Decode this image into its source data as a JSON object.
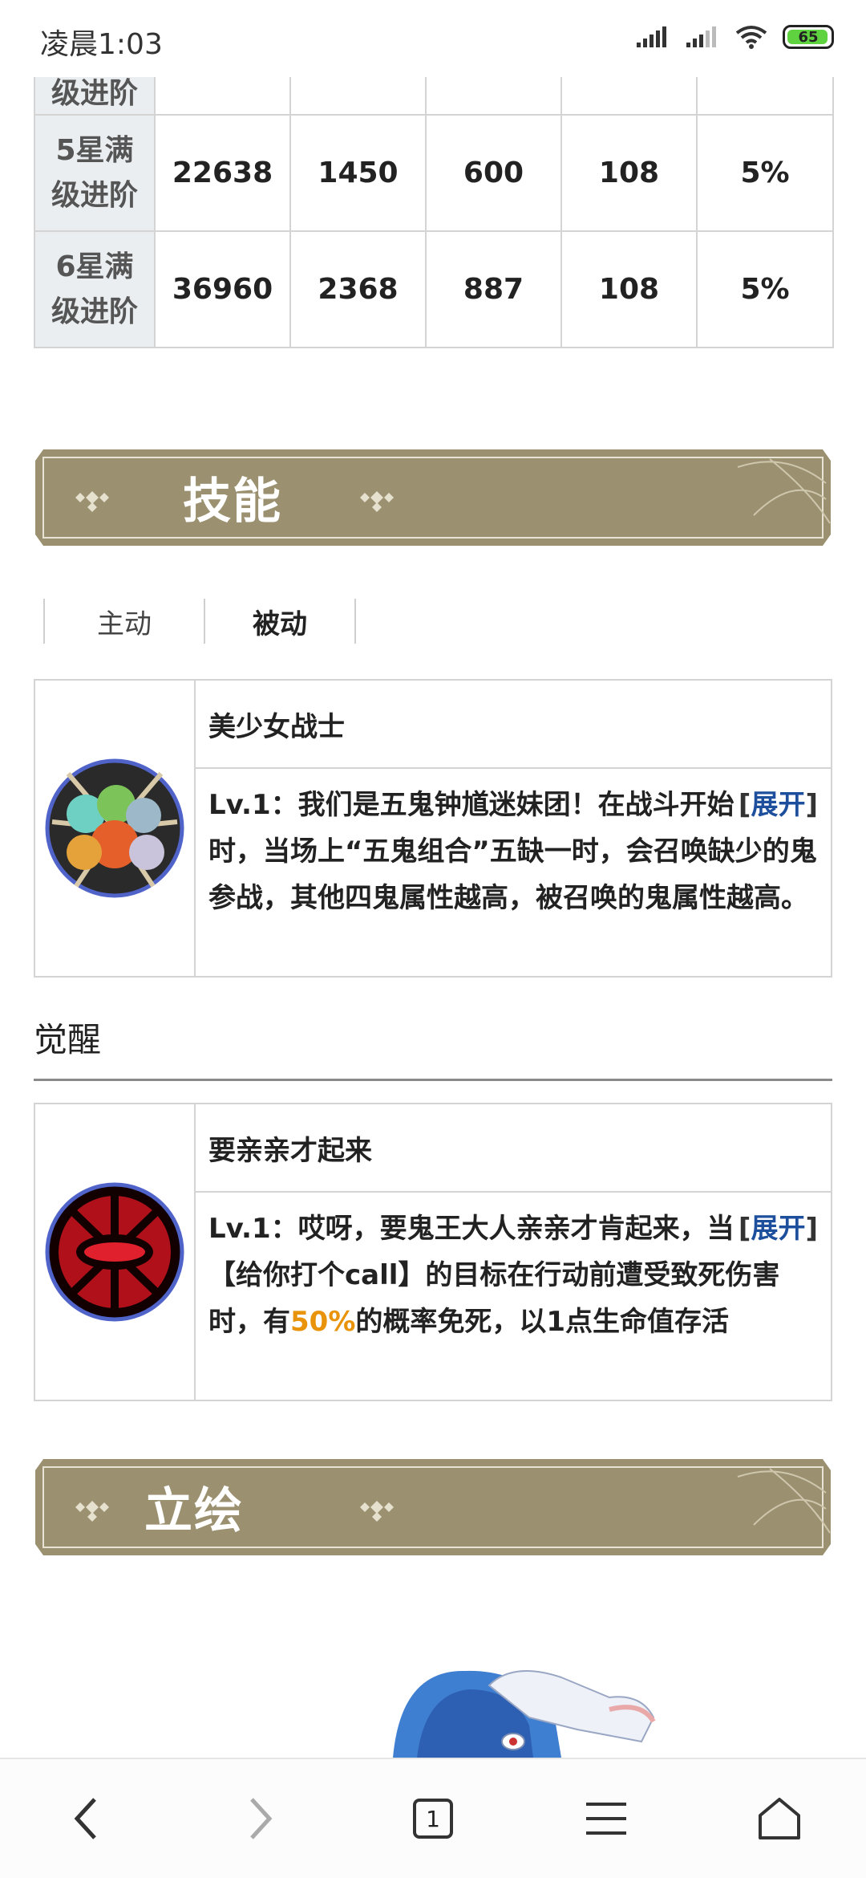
{
  "status_bar": {
    "time": "凌晨1:03",
    "battery": "65"
  },
  "stats_table": {
    "partial_row_label": "级进阶",
    "rows": [
      {
        "label_line1": "5星满",
        "label_line2": "级进阶",
        "values": [
          "22638",
          "1450",
          "600",
          "108",
          "5%"
        ]
      },
      {
        "label_line1": "6星满",
        "label_line2": "级进阶",
        "values": [
          "36960",
          "2368",
          "887",
          "108",
          "5%"
        ]
      }
    ]
  },
  "skills_section": {
    "title": "技能",
    "tabs": [
      {
        "label": "主动",
        "active": false
      },
      {
        "label": "被动",
        "active": true
      }
    ],
    "skill": {
      "name": "美少女战士",
      "desc": "Lv.1：我们是五鬼钟馗迷妹团！在战斗开始时，当场上“五鬼组合”五缺一时，会召唤缺少的鬼参战，其他四鬼属性越高，被召唤的鬼属性越高。",
      "expand_open": "[",
      "expand_link": "展开",
      "expand_close": "]"
    }
  },
  "awaken": {
    "heading": "觉醒",
    "skill": {
      "name": "要亲亲才起来",
      "desc_before": "Lv.1：哎呀，要鬼王大人亲亲才肯起来，当【给你打个call】的目标在行动前遭受致死伤害时，有",
      "highlight": "50%",
      "desc_after": "的概率免死，以1点生命值存活",
      "expand_open": "[",
      "expand_link": "展开",
      "expand_close": "]"
    }
  },
  "illustration_section": {
    "title": "立绘"
  },
  "bottom_nav": {
    "tab_count": "1"
  },
  "colors": {
    "banner": "#9b9170",
    "link": "#1d4f9c",
    "highlight": "#e8930a",
    "row_head_bg": "#eaeef0"
  }
}
